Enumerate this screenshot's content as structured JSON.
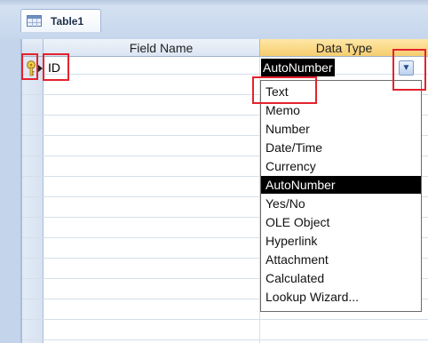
{
  "tab": {
    "label": "Table1",
    "icon": "table-icon"
  },
  "grid": {
    "headers": {
      "field_name": "Field Name",
      "data_type": "Data Type"
    },
    "rows": [
      {
        "field_name": "ID",
        "data_type": "AutoNumber",
        "primary_key": true
      }
    ],
    "icons": {
      "primary_key": "key-icon",
      "dropdown": "chevron-down-icon"
    }
  },
  "dropdown": {
    "options": [
      "Text",
      "Memo",
      "Number",
      "Date/Time",
      "Currency",
      "AutoNumber",
      "Yes/No",
      "OLE Object",
      "Hyperlink",
      "Attachment",
      "Calculated",
      "Lookup Wizard..."
    ],
    "selected": "AutoNumber"
  },
  "colors": {
    "highlight": "#e3232d",
    "header_active": "#f6cd6e",
    "selected_bg": "#000000",
    "ribbon_blue": "#c4d4eb"
  }
}
